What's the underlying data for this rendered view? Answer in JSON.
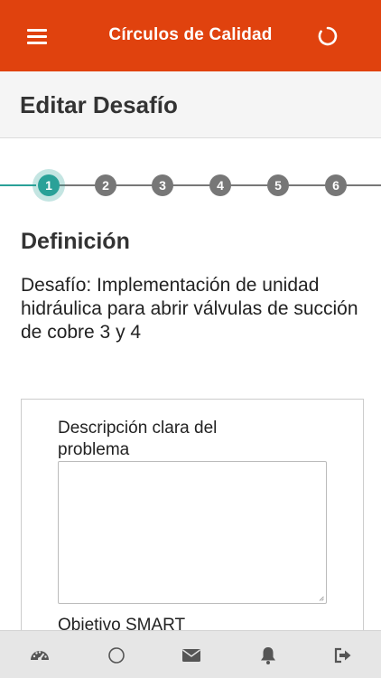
{
  "app": {
    "title": "Círculos de Calidad",
    "header_color": "#e0420e"
  },
  "header": {
    "menu_icon": "hamburger-menu-icon",
    "spinner_icon": "circle-spinner-icon"
  },
  "page": {
    "title": "Editar Desafío"
  },
  "stepper": {
    "current_step": 1,
    "active_color": "#2aa198",
    "inactive_color": "#777777",
    "steps": [
      {
        "label": "1"
      },
      {
        "label": "2"
      },
      {
        "label": "3"
      },
      {
        "label": "4"
      },
      {
        "label": "5"
      },
      {
        "label": "6"
      }
    ]
  },
  "section": {
    "title": "Definición",
    "challenge": "Desafío: Implementación de unidad hidráulica para abrir válvulas de succión de cobre 3 y 4"
  },
  "form": {
    "problem_label": "Descripción clara del problema",
    "problem_value": "",
    "smart_label": "Objetivo SMART"
  },
  "bottom_nav": {
    "items": [
      {
        "icon": "dashboard-icon"
      },
      {
        "icon": "circle-icon"
      },
      {
        "icon": "envelope-icon"
      },
      {
        "icon": "bell-icon"
      },
      {
        "icon": "sign-out-icon"
      }
    ]
  }
}
